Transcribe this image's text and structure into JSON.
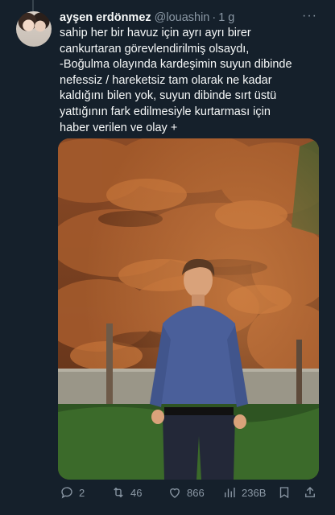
{
  "tweet": {
    "author_name": "ayşen erdönmez",
    "author_handle": "@louashin",
    "separator": "·",
    "time": "1 g",
    "more_glyph": "···",
    "lines": [
      "sahip her bir havuz için ayrı ayrı birer",
      "cankurtaran görevlendirilmiş olsaydı,",
      "-Boğulma olayında kardeşimin suyun dibinde",
      "nefessiz / hareketsiz tam olarak ne kadar",
      "kaldığını bilen yok, suyun dibinde sırt üstü",
      "yattığının fark edilmesiyle kurtarması için",
      "haber verilen ve olay +"
    ]
  },
  "actions": {
    "replies": "2",
    "retweets": "46",
    "likes": "866",
    "views": "236B"
  },
  "colors": {
    "background": "#15202b",
    "muted": "#8b98a5",
    "text": "#f7f9f9"
  }
}
